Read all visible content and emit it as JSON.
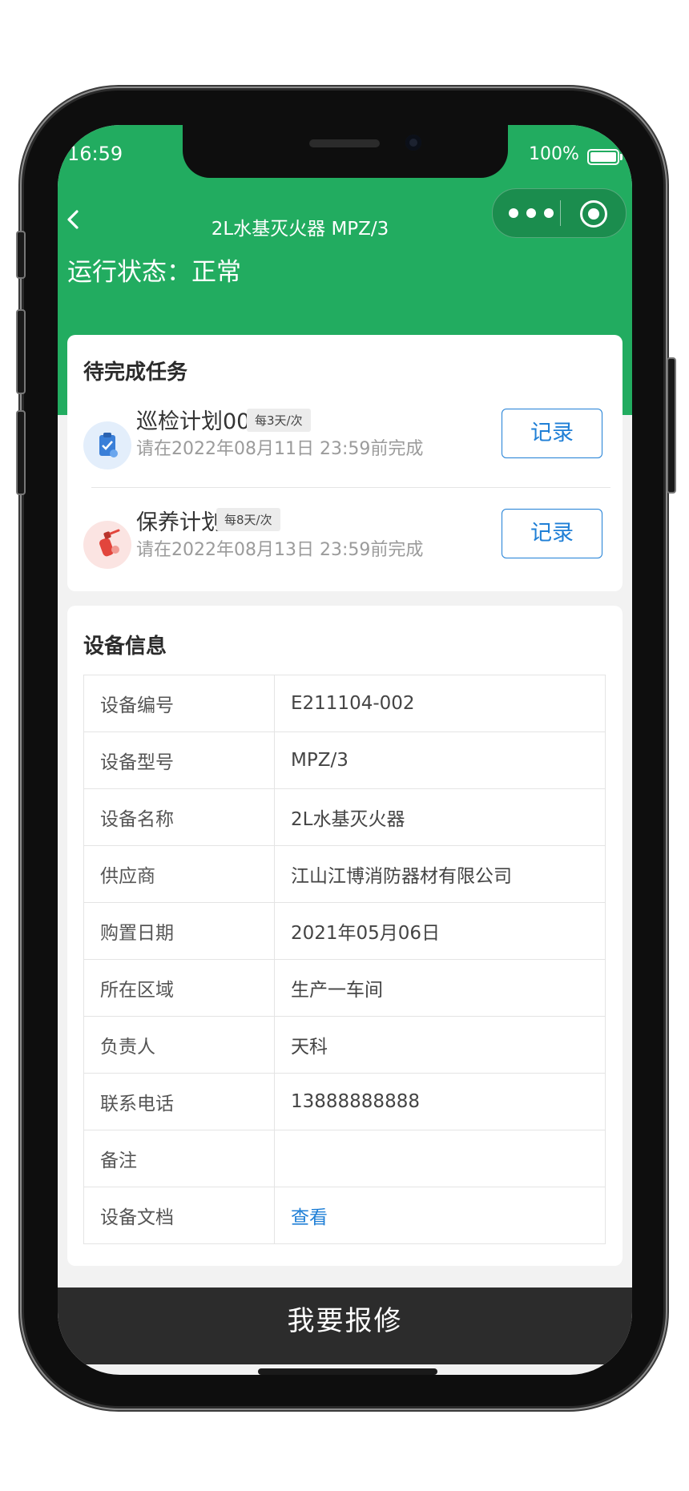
{
  "status_bar": {
    "time": "16:59",
    "battery_text": "100%"
  },
  "nav": {
    "title": "2L水基灭火器 MPZ/3"
  },
  "run_status": "运行状态：正常",
  "tasks_card": {
    "title": "待完成任务",
    "items": [
      {
        "name": "巡检计划007",
        "badge": "每3天/次",
        "deadline": "请在2022年08月11日 23:59前完成",
        "button": "记录",
        "icon": "clipboard-check-icon",
        "icon_color": "#3a7fd8"
      },
      {
        "name": "保养计划",
        "badge": "每8天/次",
        "deadline": "请在2022年08月13日 23:59前完成",
        "button": "记录",
        "icon": "fire-extinguisher-icon",
        "icon_color": "#e2453c"
      }
    ]
  },
  "device_card": {
    "title": "设备信息",
    "rows": [
      {
        "key": "设备编号",
        "value": "E211104-002"
      },
      {
        "key": "设备型号",
        "value": "MPZ/3"
      },
      {
        "key": "设备名称",
        "value": "2L水基灭火器"
      },
      {
        "key": "供应商",
        "value": "江山江博消防器材有限公司"
      },
      {
        "key": "购置日期",
        "value": "2021年05月06日"
      },
      {
        "key": "所在区域",
        "value": "生产一车间"
      },
      {
        "key": "负责人",
        "value": "天科"
      },
      {
        "key": "联系电话",
        "value": "13888888888"
      },
      {
        "key": "备注",
        "value": ""
      },
      {
        "key": "设备文档",
        "value": "查看"
      }
    ]
  },
  "repair_button": "我要报修",
  "colors": {
    "primary_green": "#22ac60",
    "link_blue": "#1f7fd6",
    "dark_bar": "#2c2c2c"
  }
}
